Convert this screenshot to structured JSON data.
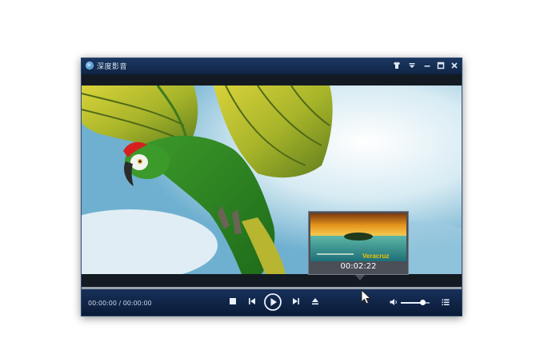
{
  "window": {
    "title": "深度影音"
  },
  "player": {
    "time_display": "00:00:00 / 00:00:00",
    "volume_level": 0.75
  },
  "preview": {
    "time": "00:02:22",
    "label": "Veracruz"
  },
  "colors": {
    "titlebar": "#1b3760",
    "controlbar": "#17305a",
    "accent": "#f2c100"
  }
}
